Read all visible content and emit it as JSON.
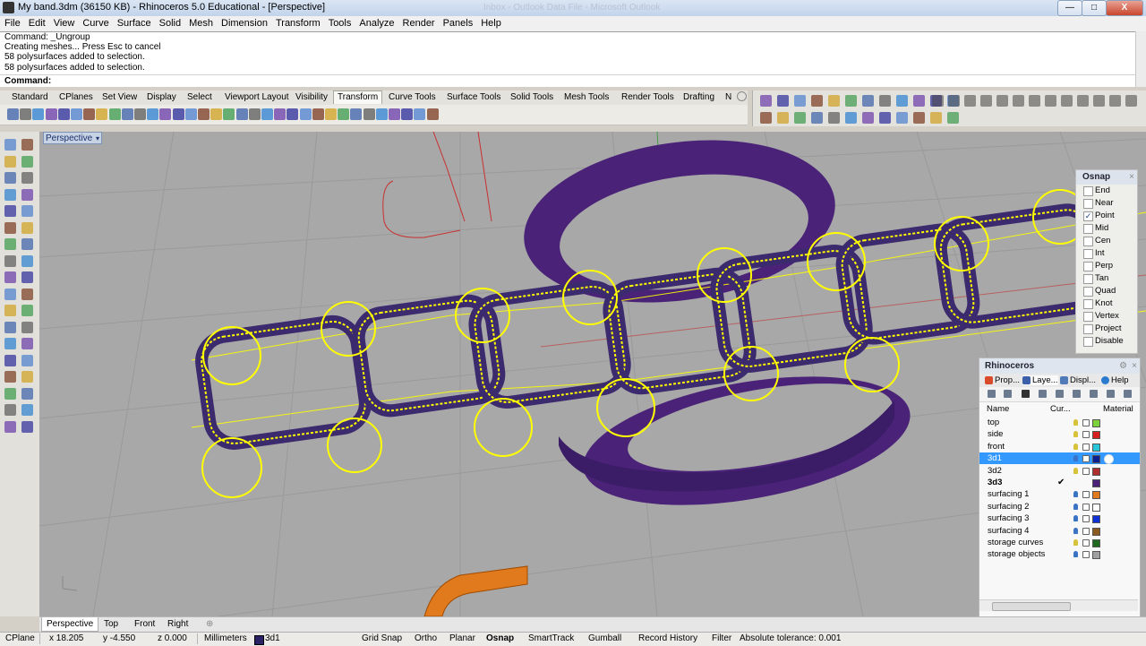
{
  "window": {
    "title": "My band.3dm (36150 KB) - Rhinoceros 5.0 Educational - [Perspective]",
    "ghost_title": "Inbox - Outlook Data File - Microsoft Outlook",
    "minimize": "—",
    "maximize": "□",
    "close": "X"
  },
  "menu": [
    "File",
    "Edit",
    "View",
    "Curve",
    "Surface",
    "Solid",
    "Mesh",
    "Dimension",
    "Transform",
    "Tools",
    "Analyze",
    "Render",
    "Panels",
    "Help"
  ],
  "command_history": [
    "Command: _Ungroup",
    "Creating meshes... Press Esc to cancel",
    "58 polysurfaces added to selection.",
    "58 polysurfaces added to selection."
  ],
  "command_prompt": "Command:",
  "toolbar_tabs": [
    "Standard",
    "CPlanes",
    "Set View",
    "Display",
    "Select",
    "Viewport Layout",
    "Visibility",
    "Transform",
    "Curve Tools",
    "Surface Tools",
    "Solid Tools",
    "Mesh Tools",
    "Render Tools",
    "Drafting"
  ],
  "toolbar_tabs_more": "N",
  "active_toolbar_tab": "Transform",
  "viewport": {
    "name": "Perspective",
    "dropdown": "▾"
  },
  "osnap": {
    "title": "Osnap",
    "close": "×",
    "items": [
      {
        "label": "End",
        "checked": false
      },
      {
        "label": "Near",
        "checked": false
      },
      {
        "label": "Point",
        "checked": true
      },
      {
        "label": "Mid",
        "checked": false
      },
      {
        "label": "Cen",
        "checked": false
      },
      {
        "label": "Int",
        "checked": false
      },
      {
        "label": "Perp",
        "checked": false
      },
      {
        "label": "Tan",
        "checked": false
      },
      {
        "label": "Quad",
        "checked": false
      },
      {
        "label": "Knot",
        "checked": false
      },
      {
        "label": "Vertex",
        "checked": false
      },
      {
        "label": "Project",
        "checked": false
      },
      {
        "label": "Disable",
        "checked": false
      }
    ]
  },
  "rhino_panel": {
    "title": "Rhinoceros",
    "gear": "⚙",
    "close": "×",
    "tabs": [
      "Prop...",
      "Laye...",
      "Displ...",
      "Help"
    ],
    "columns": {
      "name": "Name",
      "current": "Cur...",
      "material": "Material"
    },
    "layers": [
      {
        "name": "top",
        "color": "#7fd13b",
        "visible": false,
        "selected": false,
        "current": false,
        "bold": false
      },
      {
        "name": "side",
        "color": "#d62020",
        "visible": false,
        "selected": false,
        "current": false,
        "bold": false
      },
      {
        "name": "front",
        "color": "#27c6d9",
        "visible": false,
        "selected": false,
        "current": false,
        "bold": false
      },
      {
        "name": "3d1",
        "color": "#0a1f8f",
        "visible": true,
        "selected": true,
        "current": false,
        "bold": false
      },
      {
        "name": "3d2",
        "color": "#b03030",
        "visible": false,
        "selected": false,
        "current": false,
        "bold": false
      },
      {
        "name": "3d3",
        "color": "#4a2378",
        "visible": true,
        "selected": false,
        "current": true,
        "bold": true
      },
      {
        "name": "surfacing 1",
        "color": "#e07a1c",
        "visible": true,
        "selected": false,
        "current": false,
        "bold": false
      },
      {
        "name": "surfacing 2",
        "color": "#ffffff",
        "visible": true,
        "selected": false,
        "current": false,
        "bold": false
      },
      {
        "name": "surfacing 3",
        "color": "#1030d8",
        "visible": true,
        "selected": false,
        "current": false,
        "bold": false
      },
      {
        "name": "surfacing 4",
        "color": "#8a5a20",
        "visible": true,
        "selected": false,
        "current": false,
        "bold": false
      },
      {
        "name": "storage curves",
        "color": "#206a20",
        "visible": false,
        "selected": false,
        "current": false,
        "bold": false
      },
      {
        "name": "storage objects",
        "color": "#a0a0a0",
        "visible": true,
        "selected": false,
        "current": false,
        "bold": false
      }
    ],
    "current_mark": "✔"
  },
  "viewport_tabs": [
    "Perspective",
    "Top",
    "Front",
    "Right"
  ],
  "viewport_tabs_add": "⊕",
  "status": {
    "cplane": "CPlane",
    "x": "x 18.205",
    "y": "y -4.550",
    "z": "z 0.000",
    "units": "Millimeters",
    "layer": "3d1",
    "grid_snap": "Grid Snap",
    "ortho": "Ortho",
    "planar": "Planar",
    "osnap": "Osnap",
    "smarttrack": "SmartTrack",
    "gumball": "Gumball",
    "record_history": "Record History",
    "filter": "Filter",
    "tolerance": "Absolute tolerance: 0.001"
  },
  "colors": {
    "selection_yellow": "#ffff00",
    "band_purple": "#4a2378",
    "selected_row": "#3399ff",
    "viewport_bg": "#a8a8a8"
  }
}
